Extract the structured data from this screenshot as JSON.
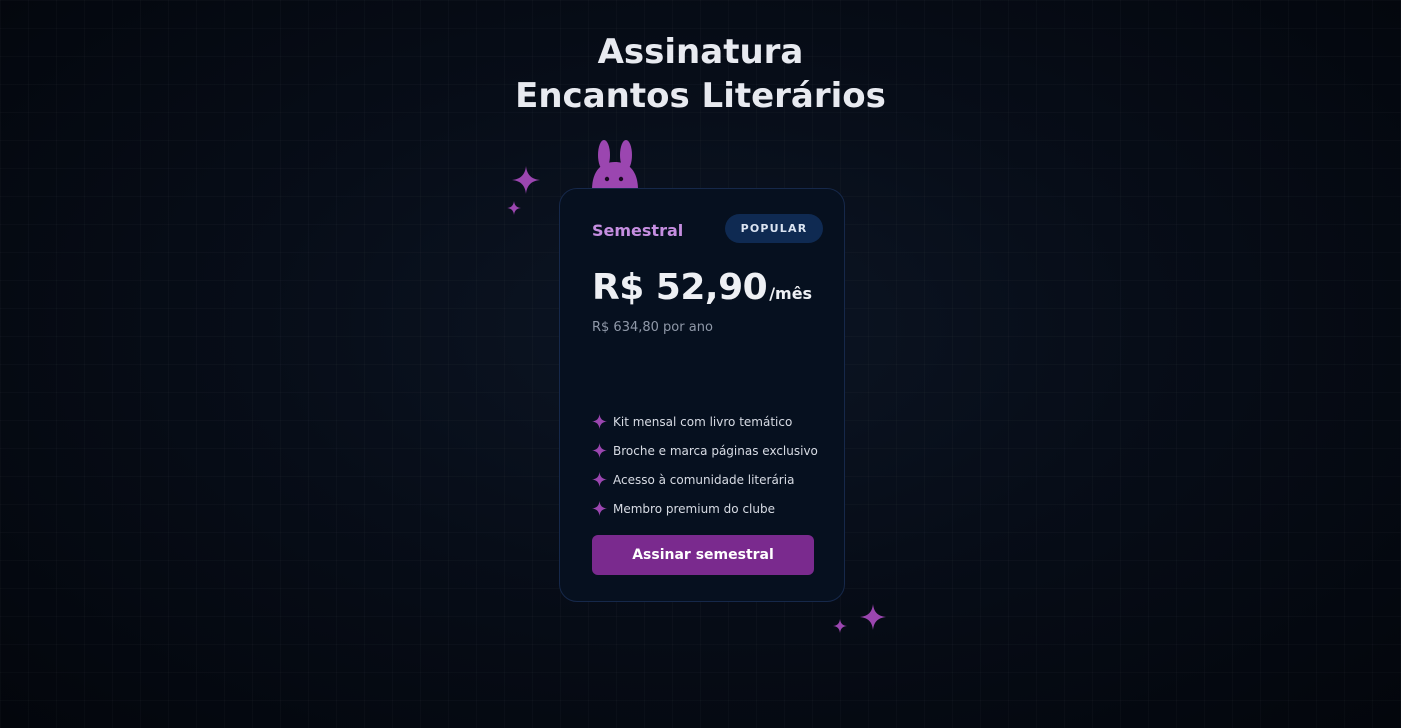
{
  "page": {
    "title_line1": "Assinatura",
    "title_line2": "Encantos Literários"
  },
  "plan": {
    "name": "Semestral",
    "badge": "POPULAR",
    "price": "R$ 52,90",
    "period": "/mês",
    "annual_note": "R$ 634,80 por ano",
    "features": [
      "Kit mensal com livro temático",
      "Broche e marca páginas exclusivo",
      "Acesso à comunidade literária",
      "Membro premium do clube"
    ],
    "cta_label": "Assinar semestral"
  },
  "colors": {
    "accent": "#7a2a8e",
    "accent_light": "#c58ee0",
    "sparkle": "#9b46b0",
    "badge_bg": "#0f2a52",
    "card_bg": "#06101f"
  },
  "icons": {
    "feature_bullet": "sparkle-icon",
    "mascot": "bunny-icon"
  }
}
